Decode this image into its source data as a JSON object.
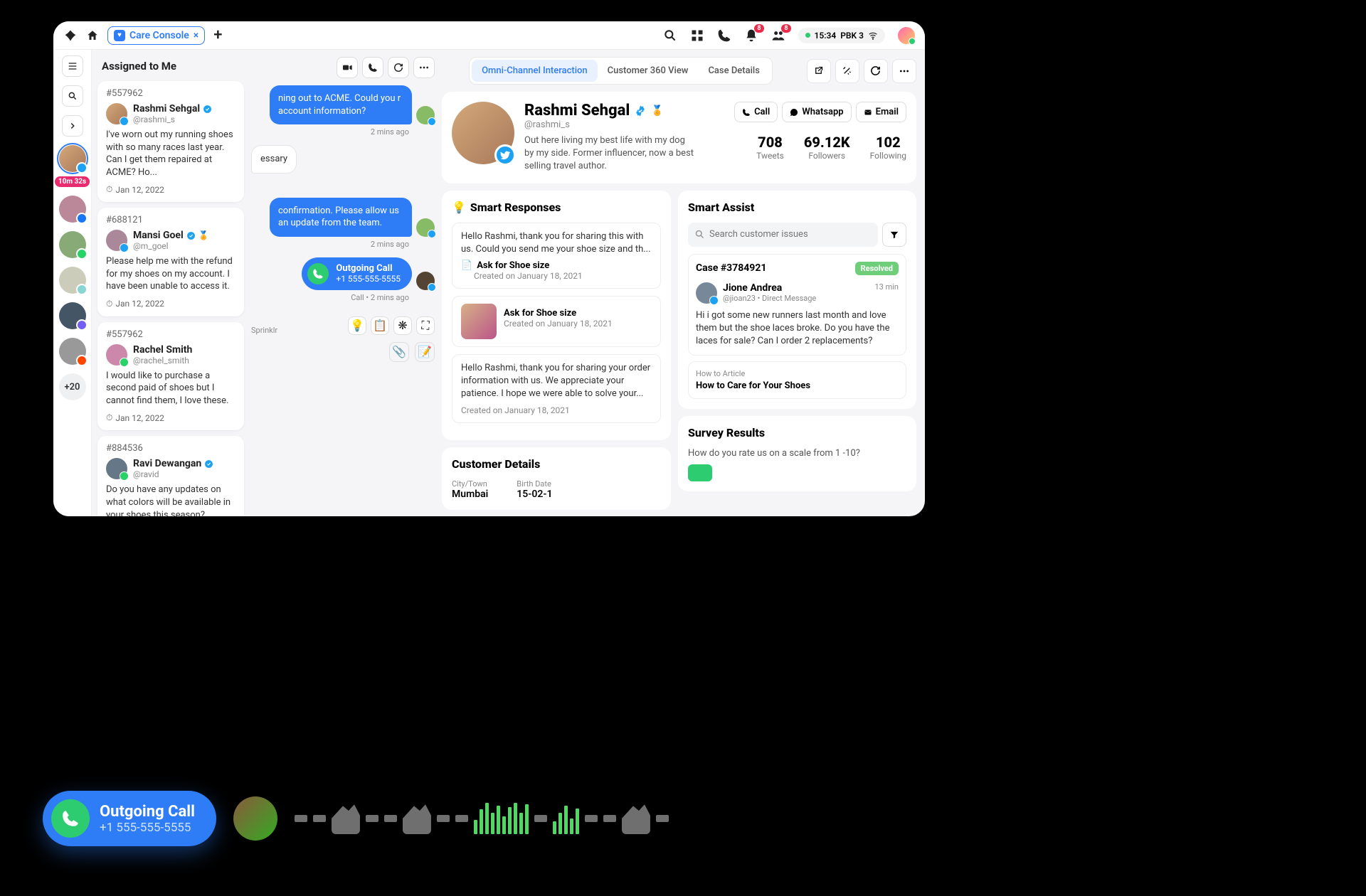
{
  "topbar": {
    "tab_label": "Care Console",
    "time": "15:34",
    "location": "PBK 3",
    "notif_count": "8",
    "people_count": "8"
  },
  "leftrail": {
    "timer": "10m 32s",
    "more": "+20"
  },
  "assigned": {
    "heading": "Assigned to Me",
    "cards": [
      {
        "id": "#557962",
        "name": "Rashmi Sehgal",
        "handle": "@rashmi_s",
        "text": "I've worn out my running shoes with so many races last year. Can I get them repaired at ACME? Ho...",
        "date": "Jan 12, 2022",
        "verified": true,
        "star": false
      },
      {
        "id": "#688121",
        "name": "Mansi Goel",
        "handle": "@m_goel",
        "text": "Please help me with the refund for my shoes on my account. I have been unable to access it.",
        "date": "Jan 12, 2022",
        "verified": true,
        "star": true
      },
      {
        "id": "#557962",
        "name": "Rachel Smith",
        "handle": "@rachel_smith",
        "text": "I would like to purchase a second paid of shoes but I cannot find them, I love these.",
        "date": "Jan 12, 2022",
        "verified": false,
        "star": false
      },
      {
        "id": "#884536",
        "name": "Ravi Dewangan",
        "handle": "@ravid",
        "text": "Do you have any updates on what colors will be available in your shoes this season?",
        "date": "",
        "verified": true,
        "star": false
      }
    ]
  },
  "convo": {
    "msg1": "ning out to ACME. Could you r account information?",
    "meta1": "2 mins ago",
    "msg2": "essary",
    "msg3": "confirmation. Please allow us an update from the team.",
    "meta3": "2 mins ago",
    "call_title": "Outgoing Call",
    "call_number": "+1 555-555-5555",
    "call_meta": "Call • 2 mins ago",
    "powered": "Sprinklr"
  },
  "tabs": [
    "Omni-Channel Interaction",
    "Customer 360 View",
    "Case Details"
  ],
  "profile": {
    "name": "Rashmi Sehgal",
    "handle": "@rashmi_s",
    "bio": "Out here living my best life with my dog by my side. Former influencer, now a best selling travel author.",
    "cta_call": "Call",
    "cta_whatsapp": "Whatsapp",
    "cta_email": "Email",
    "stats": [
      {
        "val": "708",
        "lbl": "Tweets"
      },
      {
        "val": "69.12K",
        "lbl": "Followers"
      },
      {
        "val": "102",
        "lbl": "Following"
      }
    ]
  },
  "smart_responses": {
    "title": "Smart Responses",
    "items": [
      {
        "text": "Hello Rashmi, thank you for sharing this with us. Could you send me your shoe size and th...",
        "title": "Ask for Shoe size",
        "meta": "Created on January 18, 2021"
      },
      {
        "text": "",
        "title": "Ask for Shoe size",
        "meta": "Created on January 18, 2021",
        "thumb": true
      },
      {
        "text": "Hello Rashmi, thank you for sharing your order information with us. We appreciate your patience. I hope we were able to solve your...",
        "title": "",
        "meta": "Created on January 18, 2021"
      }
    ]
  },
  "smart_assist": {
    "title": "Smart Assist",
    "search_placeholder": "Search customer issues",
    "case_id": "Case #3784921",
    "resolved": "Resolved",
    "user_name": "Jione Andrea",
    "user_handle": "@jioan23 • Direct Message",
    "time": "13 min",
    "msg": "Hi i got some new runners last month and love them but the shoe laces broke. Do you have the laces for sale? Can I order 2 replacements?",
    "article_tag": "How to Article",
    "article_title": "How to Care for Your Shoes"
  },
  "customer_details": {
    "title": "Customer Details",
    "city_lbl": "City/Town",
    "city_val": "Mumbai",
    "birth_lbl": "Birth Date",
    "birth_val": "15-02-1"
  },
  "survey": {
    "title": "Survey Results",
    "question": "How do you rate us on a scale from 1 -10?"
  },
  "float": {
    "title": "Outgoing Call",
    "number": "+1 555-555-5555"
  }
}
